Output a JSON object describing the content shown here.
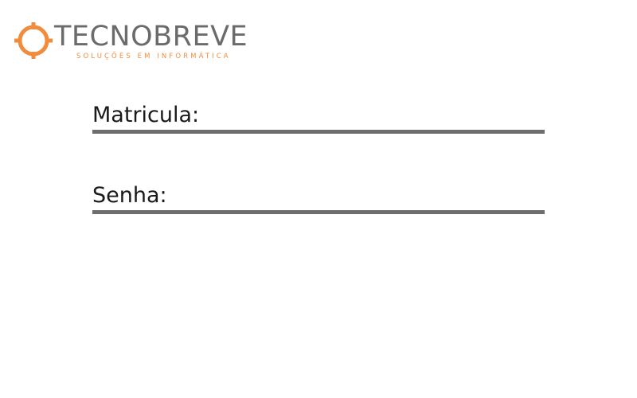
{
  "logo": {
    "brand_name": "TECNOBREVE",
    "tagline": "SOLUÇÕES EM INFORMÁTICA",
    "icon": "crosshair-icon",
    "brand_color": "#6b6b6b",
    "accent_color": "#f08c3c"
  },
  "form": {
    "matricula_label": "Matricula:",
    "matricula_value": "",
    "senha_label": "Senha:",
    "senha_value": "",
    "underline_color": "#6e6e6e"
  }
}
